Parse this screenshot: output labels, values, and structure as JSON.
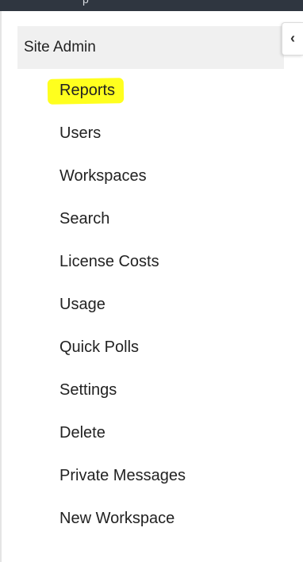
{
  "top_bar": {
    "caption": "p"
  },
  "sidebar": {
    "header": "Site Admin",
    "collapse_glyph": "‹",
    "highlight_color": "#ffff1e",
    "items": [
      {
        "label": "Reports"
      },
      {
        "label": "Users"
      },
      {
        "label": "Workspaces"
      },
      {
        "label": "Search"
      },
      {
        "label": "License Costs"
      },
      {
        "label": "Usage"
      },
      {
        "label": "Quick Polls"
      },
      {
        "label": "Settings"
      },
      {
        "label": "Delete"
      },
      {
        "label": "Private Messages"
      },
      {
        "label": "New Workspace"
      }
    ]
  }
}
